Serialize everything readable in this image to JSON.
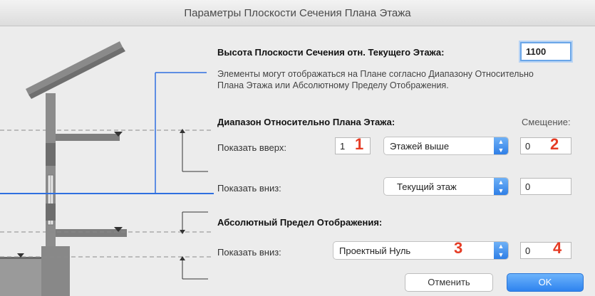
{
  "window": {
    "title": "Параметры Плоскости Сечения Плана Этажа"
  },
  "cut_plane": {
    "label": "Высота Плоскости Сечения отн. Текущего Этажа:",
    "value": "1100"
  },
  "description": "Элементы могут отображаться на Плане согласно Диапазону Относительно Плана Этажа или Абсолютному Пределу Отображения.",
  "relative_range": {
    "heading": "Диапазон Относительно Плана Этажа:",
    "offset_heading": "Смещение:",
    "show_up": {
      "label": "Показать вверх:",
      "count": "1",
      "select": "Этажей выше",
      "offset": "0"
    },
    "show_down": {
      "label": "Показать вниз:",
      "select": "Текущий этаж",
      "offset": "0"
    }
  },
  "absolute_limit": {
    "heading": "Абсолютный Предел Отображения:",
    "show_down": {
      "label": "Показать вниз:",
      "select": "Проектный Нуль",
      "offset": "0"
    }
  },
  "markers": [
    "1",
    "2",
    "3",
    "4"
  ],
  "buttons": {
    "cancel": "Отменить",
    "ok": "OK"
  },
  "colors": {
    "accent": "#2e83ef",
    "cut_line": "#2f6fe0",
    "marker": "#e53c25"
  }
}
